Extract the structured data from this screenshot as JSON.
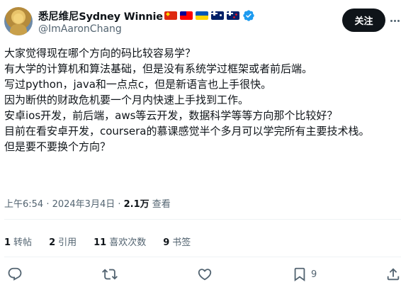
{
  "author": {
    "display_name": "悉尼维尼Sydney Winnie",
    "handle": "@ImAaronChang",
    "flags": [
      "cn-flag",
      "tw-flag",
      "ua-flag",
      "au-flag",
      "nz-flag"
    ],
    "verified": true
  },
  "follow_label": "关注",
  "tweet_lines": [
    "大家觉得现在哪个方向的码比较容易学？",
    "有大学的计算机和算法基础，但是没有系统学过框架或者前后端。",
    "写过python，java和一点点c，但是新语言也上手很快。",
    "因为断供的财政危机要一个月内快速上手找到工作。",
    "安卓ios开发，前后端，aws等云开发，数据科学等等方向那个比较好？",
    "目前在看安卓开发，coursera的慕课感觉半个多月可以学完所有主要技术栈。",
    "但是要不要换个方向？"
  ],
  "meta": {
    "time": "上午6:54 · 2024年3月4日 · ",
    "views_count": "2.1万",
    "views_label": " 查看"
  },
  "stats": {
    "retweets": {
      "count": "1",
      "label": "转帖"
    },
    "quotes": {
      "count": "2",
      "label": "引用"
    },
    "likes": {
      "count": "11",
      "label": "喜欢次数"
    },
    "bookmarks": {
      "count": "9",
      "label": "书签"
    }
  },
  "actions": {
    "bookmark_count": "9"
  },
  "colors": {
    "text": "#0f1419",
    "secondary": "#536471",
    "verified": "#1d9bf0",
    "follow_bg": "#0f1419"
  }
}
